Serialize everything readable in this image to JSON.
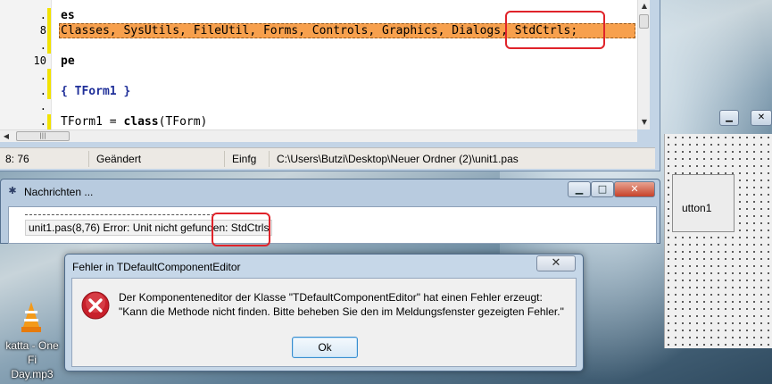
{
  "editor": {
    "lines": [
      {
        "num": ".",
        "text": "es",
        "kind": "kw"
      },
      {
        "num": "8",
        "text": "Classes, SysUtils, FileUtil, Forms, Controls, Graphics, Dialogs, StdCtrls;",
        "kind": "plain"
      },
      {
        "num": ".",
        "text": "",
        "kind": "plain"
      },
      {
        "num": "10",
        "text": "pe",
        "kind": "kw"
      },
      {
        "num": ".",
        "text": "",
        "kind": "plain"
      },
      {
        "num": ".",
        "text": "{ TForm1 }",
        "kind": "cm"
      },
      {
        "num": ".",
        "text": "",
        "kind": "plain"
      },
      {
        "num": ".",
        "text_a": "TForm1 = ",
        "text_b": "class",
        "text_c": "(TForm)",
        "kind": "mixed"
      }
    ],
    "status": {
      "cursor": "8: 76",
      "modified": "Geändert",
      "mode": "Einfg",
      "path": "C:\\Users\\Butzi\\Desktop\\Neuer Ordner (2)\\unit1.pas"
    }
  },
  "messages": {
    "title": "Nachrichten ...",
    "dash": "----------------------------------------",
    "error_text": "unit1.pas(8,76) Error: Unit nicht gefunden: StdCtrls"
  },
  "form_designer": {
    "button_label": "utton1"
  },
  "desktop": {
    "icon_label_line1": "katta - One Fi",
    "icon_label_line2": "Day.mp3"
  },
  "dialog": {
    "title": "Fehler in TDefaultComponentEditor",
    "message_line1": "Der Komponenteneditor der Klasse \"TDefaultComponentEditor\" hat einen Fehler erzeugt:",
    "message_line2": "\"Kann die Methode nicht finden. Bitte beheben Sie den im Meldungsfenster gezeigten Fehler.\"",
    "ok_label": "Ok"
  },
  "icons": {
    "close": "close-icon",
    "minimize": "minimize-icon",
    "maximize": "maximize-icon",
    "error": "error-icon",
    "app": "lazarus-icon",
    "vlc": "vlc-cone-icon"
  },
  "colors": {
    "highlight_line": "#f7a04d",
    "annotation": "#e0232a",
    "change_marker": "#f2e200"
  }
}
